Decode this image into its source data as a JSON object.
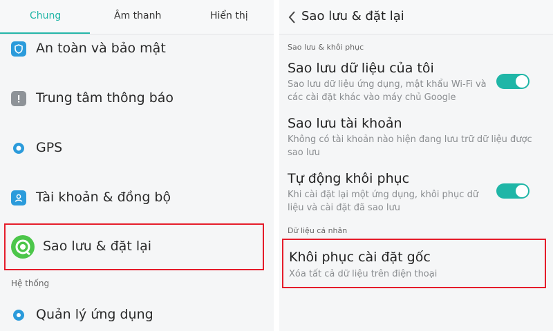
{
  "left": {
    "tabs": [
      {
        "label": "Chung",
        "active": true
      },
      {
        "label": "Âm thanh",
        "active": false
      },
      {
        "label": "Hiển thị",
        "active": false
      }
    ],
    "items": [
      {
        "label": "An toàn và bảo mật",
        "icon": "shield-icon"
      },
      {
        "label": "Trung tâm thông báo",
        "icon": "exclamation-icon"
      },
      {
        "label": "GPS",
        "icon": "location-pin-icon"
      },
      {
        "label": "Tài khoản & đồng bộ",
        "icon": "user-account-icon"
      },
      {
        "label": "Sao lưu & đặt lại",
        "icon": "backup-reset-icon",
        "highlighted": true
      }
    ],
    "section_system": "Hệ thống",
    "system_items": [
      {
        "label": "Quản lý ứng dụng",
        "icon": "gear-icon"
      }
    ]
  },
  "right": {
    "title": "Sao lưu & đặt lại",
    "section_backup": "Sao lưu & khôi phục",
    "backup_data": {
      "title": "Sao lưu dữ liệu của tôi",
      "desc": "Sao lưu dữ liệu ứng dụng, mật khẩu Wi-Fi và các cài đặt khác vào máy chủ Google",
      "enabled": true
    },
    "backup_account": {
      "title": "Sao lưu tài khoản",
      "desc": "Không có tài khoản nào hiện đang lưu trữ dữ liệu được sao lưu"
    },
    "auto_restore": {
      "title": "Tự động khôi phục",
      "desc": "Khi cài đặt lại một ứng dụng, khôi phục dữ liệu và cài đặt đã sao lưu",
      "enabled": true
    },
    "section_personal": "Dữ liệu cá nhân",
    "factory_reset": {
      "title": "Khôi phục cài đặt gốc",
      "desc": "Xóa tất cả dữ liệu trên điện thoại"
    }
  },
  "colors": {
    "accent": "#1fb5a6",
    "highlight_border": "#e51c2a",
    "icon_blue": "#2b9bdb",
    "icon_green": "#4cc64a"
  }
}
